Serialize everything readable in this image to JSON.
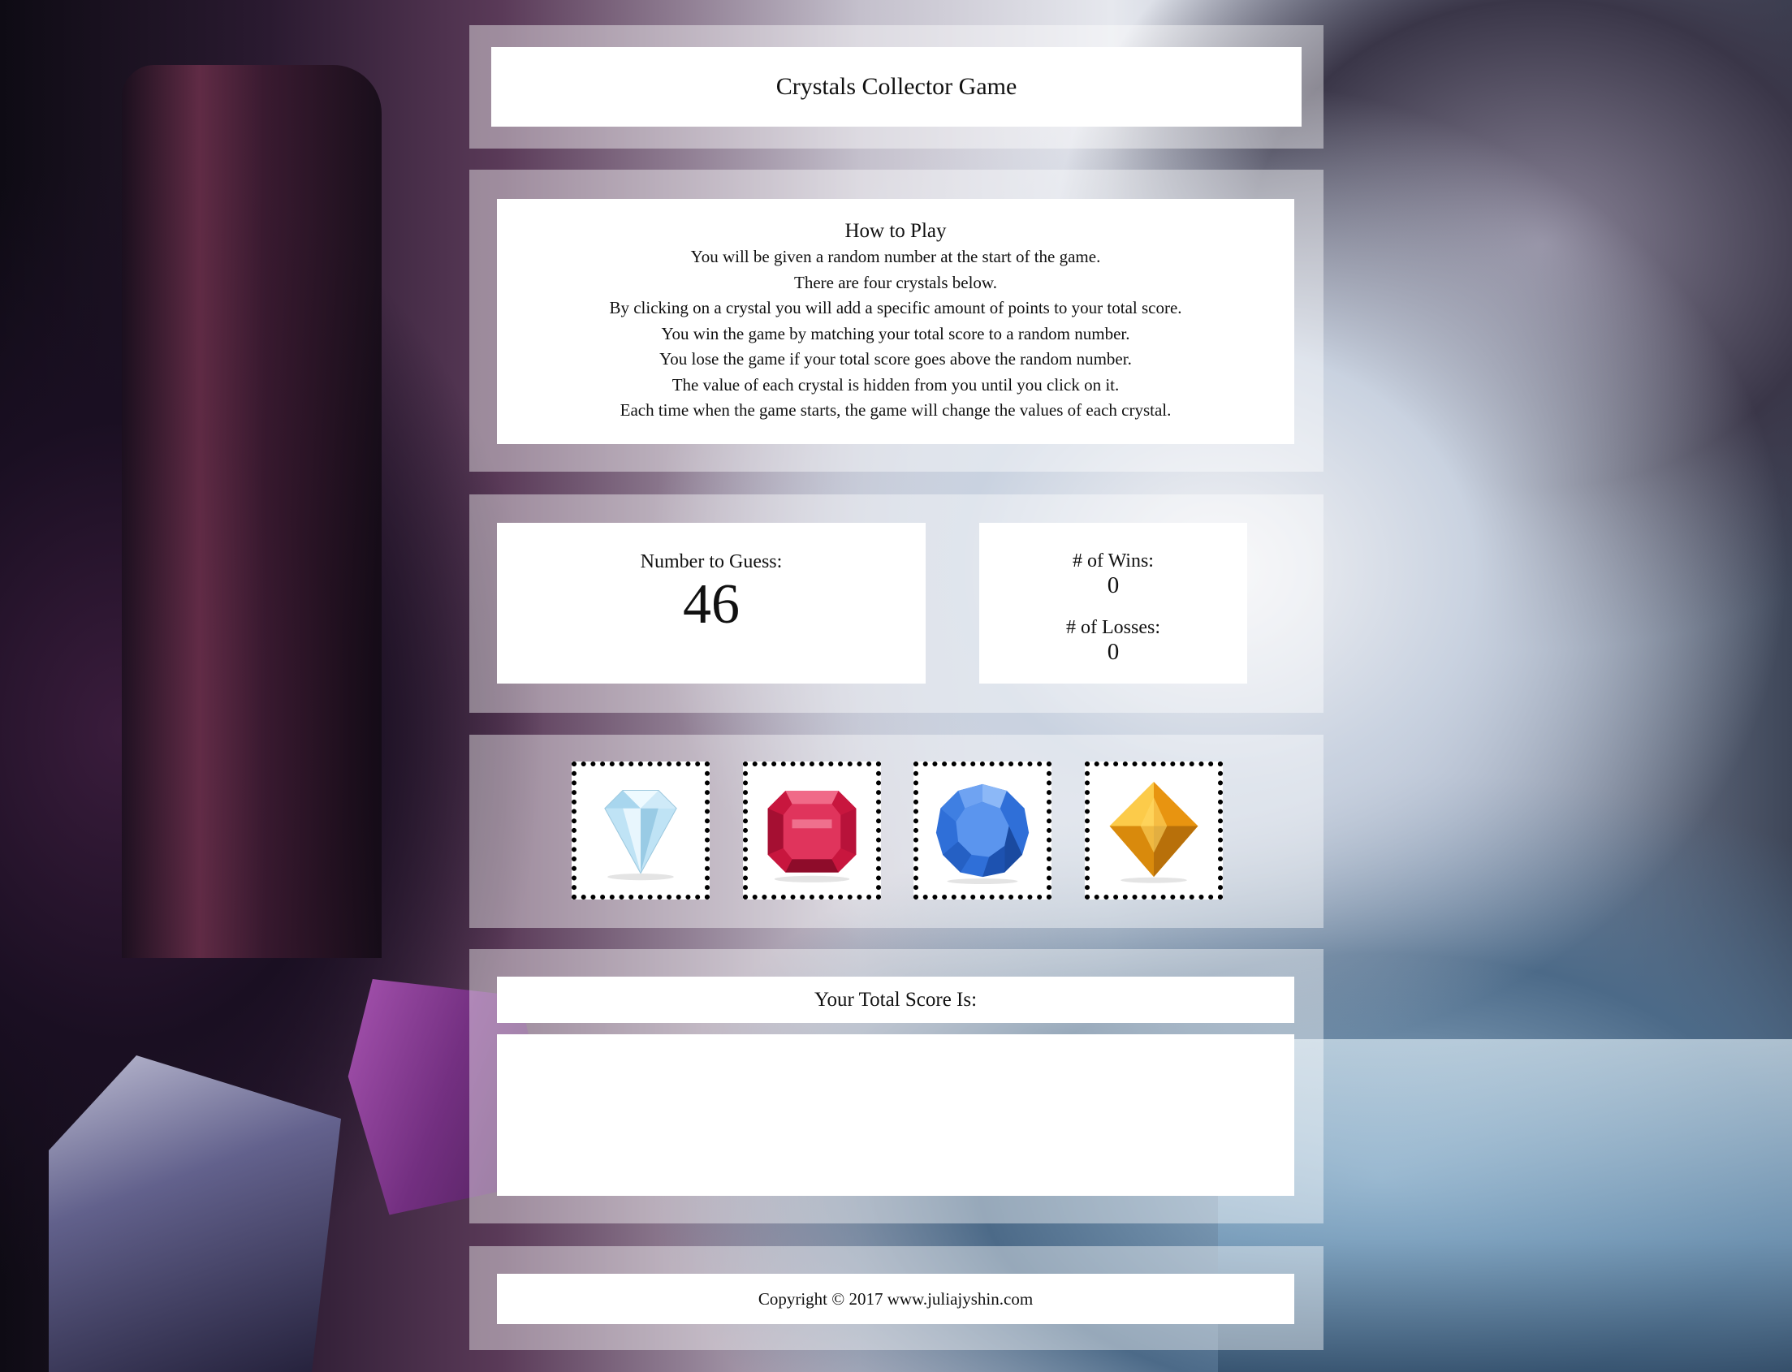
{
  "title": "Crystals Collector Game",
  "how_to_play": {
    "heading": "How to Play",
    "lines": [
      "You will be given a random number at the start of the game.",
      "There are four crystals below.",
      "By clicking on a crystal you will add a specific amount of points to your total score.",
      "You win the game by matching your total score to a random number.",
      "You lose the game if your total score goes above the random number.",
      "The value of each crystal is hidden from you until you click on it.",
      "Each time when the game starts, the game will change the values of each crystal."
    ]
  },
  "stats": {
    "number_to_guess_label": "Number to Guess:",
    "number_to_guess": "46",
    "wins_label": "# of Wins:",
    "wins": "0",
    "losses_label": "# of Losses:",
    "losses": "0"
  },
  "crystals": [
    {
      "name": "diamond",
      "icon": "white-diamond-icon",
      "color": "#bfe3f5"
    },
    {
      "name": "ruby",
      "icon": "red-ruby-icon",
      "color": "#d81f4a"
    },
    {
      "name": "sapphire",
      "icon": "blue-sapphire-icon",
      "color": "#3b7de0"
    },
    {
      "name": "topaz",
      "icon": "yellow-topaz-icon",
      "color": "#f2a81a"
    }
  ],
  "score": {
    "label": "Your Total Score Is:",
    "value": ""
  },
  "footer": {
    "copyright": "Copyright © 2017 www.juliajyshin.com"
  }
}
